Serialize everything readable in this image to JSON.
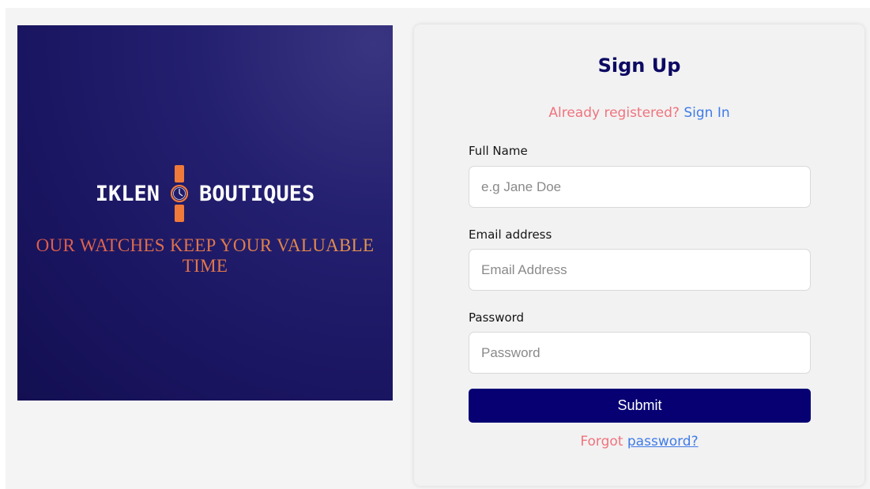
{
  "banner": {
    "brand_left": "IKLEN",
    "brand_right": "BOUTIQUES",
    "tagline": "OUR WATCHES KEEP YOUR VALUABLE TIME",
    "icon": "wristwatch-icon",
    "colors": {
      "background": "#1a1560",
      "tagline": "#e27a4a",
      "watch": "#f07a3a"
    }
  },
  "form": {
    "title": "Sign Up",
    "already_text": "Already registered?",
    "signin_link": "Sign In",
    "fields": [
      {
        "label": "Full Name",
        "placeholder": "e.g Jane Doe",
        "value": ""
      },
      {
        "label": "Email address",
        "placeholder": "Email Address",
        "value": ""
      },
      {
        "label": "Password",
        "placeholder": "Password",
        "value": ""
      }
    ],
    "submit_label": "Submit",
    "forgot_text": "Forgot",
    "forgot_link": "password?",
    "colors": {
      "title": "#0d0a63",
      "button": "#060073",
      "accent_pink": "#f0737e",
      "link_blue": "#3f7be8"
    }
  }
}
